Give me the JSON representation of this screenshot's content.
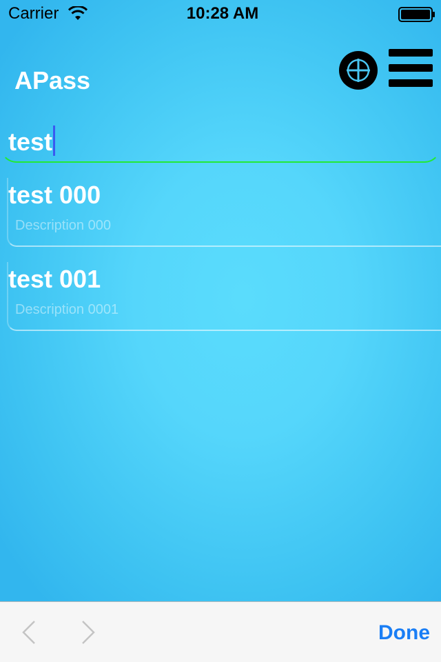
{
  "status_bar": {
    "carrier": "Carrier",
    "time": "10:28 AM"
  },
  "app": {
    "title": "APass"
  },
  "search": {
    "value": "test"
  },
  "entries": [
    {
      "title": "test 000",
      "description": "Description 000"
    },
    {
      "title": "test 001",
      "description": "Description 0001"
    }
  ],
  "toolbar": {
    "done_label": "Done"
  },
  "icons": {
    "add": "plus-circle-icon",
    "menu": "hamburger-menu-icon",
    "prev": "chevron-left-icon",
    "next": "chevron-right-icon",
    "wifi": "wifi-icon",
    "battery": "battery-icon"
  },
  "colors": {
    "background": "#55d6fb",
    "accent_field_border": "#22ea34",
    "done": "#1a7ef5",
    "caret": "#3a59f0"
  }
}
